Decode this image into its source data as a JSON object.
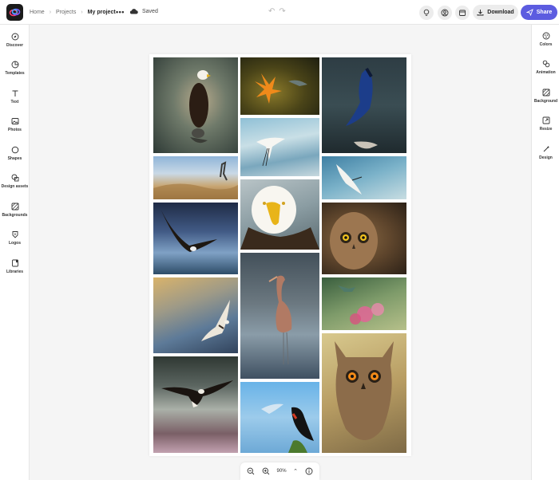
{
  "header": {
    "logo_icon": "adobe-express-logo",
    "breadcrumbs": [
      "Home",
      "Projects",
      "My project"
    ],
    "more_icon": "more-icon",
    "status": "Saved",
    "download_label": "Download",
    "share_label": "Share",
    "accent_color": "#5c5ce0"
  },
  "left_rail": {
    "items": [
      {
        "label": "Discover",
        "icon": "discover-icon"
      },
      {
        "label": "Templates",
        "icon": "templates-icon"
      },
      {
        "label": "Text",
        "icon": "text-icon"
      },
      {
        "label": "Photos",
        "icon": "photos-icon"
      },
      {
        "label": "Shapes",
        "icon": "shapes-icon"
      },
      {
        "label": "Design assets",
        "icon": "design-assets-icon"
      },
      {
        "label": "Backgrounds",
        "icon": "backgrounds-icon"
      },
      {
        "label": "Logos",
        "icon": "logos-icon"
      },
      {
        "label": "Libraries",
        "icon": "libraries-icon"
      }
    ]
  },
  "right_rail": {
    "items": [
      {
        "label": "Colors",
        "icon": "colors-icon"
      },
      {
        "label": "Animation",
        "icon": "animation-icon"
      },
      {
        "label": "Background",
        "icon": "background-icon"
      },
      {
        "label": "Resize",
        "icon": "resize-icon"
      },
      {
        "label": "Design",
        "icon": "design-icon"
      }
    ]
  },
  "canvas": {
    "photos": [
      {
        "subject": "bald eagle perched"
      },
      {
        "subject": "orange lily with hummingbird"
      },
      {
        "subject": "blue jay on branch"
      },
      {
        "subject": "heron in tall grass"
      },
      {
        "subject": "egret in flight"
      },
      {
        "subject": "tern diving"
      },
      {
        "subject": "eagle flying over water"
      },
      {
        "subject": "bald eagle portrait"
      },
      {
        "subject": "owl portrait"
      },
      {
        "subject": "reddish egret wading"
      },
      {
        "subject": "hummingbird with pink flowers"
      },
      {
        "subject": "osprey in flight"
      },
      {
        "subject": "eagle soaring"
      },
      {
        "subject": "red-winged blackbird singing"
      },
      {
        "subject": "great horned owl"
      }
    ]
  },
  "zoom": {
    "value": "90%"
  }
}
